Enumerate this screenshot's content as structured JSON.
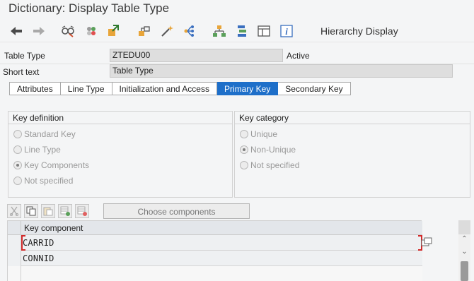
{
  "window": {
    "title": "Dictionary: Display Table Type"
  },
  "toolbar": {
    "icons": [
      "back-icon",
      "forward-icon",
      "other-object-icon",
      "display-change-icon",
      "activate-icon",
      "where-used-icon",
      "magic-wand-icon",
      "navigation-icon",
      "hierarchy-icon",
      "stack-icon",
      "layout-icon",
      "info-icon"
    ],
    "hierarchy_display_label": "Hierarchy Display"
  },
  "fields": {
    "table_type": {
      "label": "Table Type",
      "value": "ZTEDU00",
      "status": "Active"
    },
    "short_text": {
      "label": "Short text",
      "value": "Table Type"
    }
  },
  "tabs": [
    {
      "label": "Attributes",
      "active": false
    },
    {
      "label": "Line Type",
      "active": false
    },
    {
      "label": "Initialization and Access",
      "active": false
    },
    {
      "label": "Primary Key",
      "active": true
    },
    {
      "label": "Secondary Key",
      "active": false
    }
  ],
  "key_definition": {
    "title": "Key definition",
    "options": [
      {
        "label": "Standard Key",
        "checked": false
      },
      {
        "label": "Line Type",
        "checked": false
      },
      {
        "label": "Key Components",
        "checked": true
      },
      {
        "label": "Not specified",
        "checked": false
      }
    ]
  },
  "key_category": {
    "title": "Key category",
    "options": [
      {
        "label": "Unique",
        "checked": false
      },
      {
        "label": "Non-Unique",
        "checked": true
      },
      {
        "label": "Not specified",
        "checked": false
      }
    ]
  },
  "component_toolbar": {
    "icons": [
      "cut-icon",
      "copy-icon",
      "paste-icon",
      "insert-row-icon",
      "delete-row-icon"
    ],
    "choose_components_label": "Choose components"
  },
  "grid": {
    "header": "Key component",
    "rows": [
      "CARRID",
      "CONNID",
      ""
    ]
  },
  "colors": {
    "accent": "#1e6fc9",
    "focus": "#d22a2a"
  }
}
